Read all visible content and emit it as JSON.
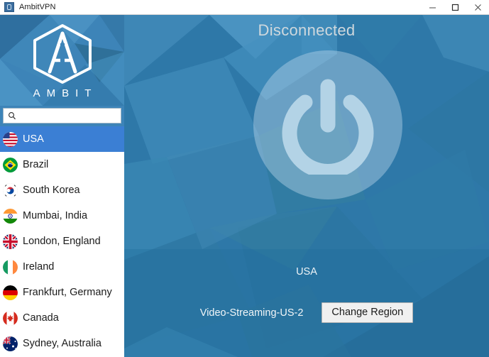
{
  "window": {
    "title": "AmbitVPN",
    "icon": "app-icon",
    "controls": {
      "minimize": "minimize-button",
      "maximize": "maximize-button",
      "close": "close-button"
    }
  },
  "sidebar": {
    "brand": {
      "logo": "ambit-hexagon-logo",
      "wordmark": "AMBIT"
    },
    "search": {
      "icon": "search-icon",
      "value": "",
      "placeholder": ""
    },
    "countries": [
      {
        "label": "USA",
        "flag": "flag-usa",
        "selected": true
      },
      {
        "label": "Brazil",
        "flag": "flag-brazil",
        "selected": false
      },
      {
        "label": "South Korea",
        "flag": "flag-south-korea",
        "selected": false
      },
      {
        "label": "Mumbai, India",
        "flag": "flag-india",
        "selected": false
      },
      {
        "label": "London, England",
        "flag": "flag-united-kingdom",
        "selected": false
      },
      {
        "label": "Ireland",
        "flag": "flag-ireland",
        "selected": false
      },
      {
        "label": "Frankfurt, Germany",
        "flag": "flag-germany",
        "selected": false
      },
      {
        "label": "Canada",
        "flag": "flag-canada",
        "selected": false
      },
      {
        "label": "Sydney, Australia",
        "flag": "flag-australia",
        "selected": false
      }
    ]
  },
  "main": {
    "status": "Disconnected",
    "power_button": "power-icon",
    "region": "USA",
    "server": "Video-Streaming-US-2",
    "change_region_label": "Change Region"
  },
  "colors": {
    "accent_blue": "#3b7fd4",
    "panel_blue": "#2e78a8",
    "brand_blue": "#3d84b8",
    "status_text": "#cfd8dd",
    "button_face": "#f0f0f0"
  }
}
